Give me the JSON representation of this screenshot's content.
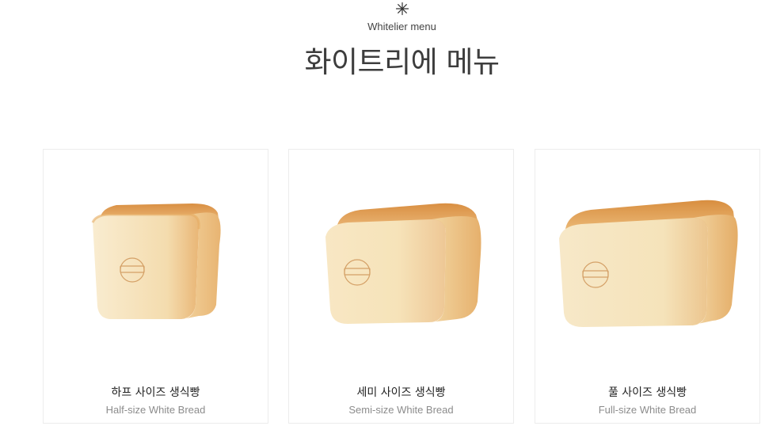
{
  "header": {
    "icon": "asterisk-icon",
    "subtitle": "Whitelier menu",
    "title": "화이트리에 메뉴"
  },
  "menu": {
    "items": [
      {
        "name": "하프 사이즈 생식빵",
        "english": "Half-size White Bread",
        "image": "half-loaf-bread-image"
      },
      {
        "name": "세미 사이즈 생식빵",
        "english": "Semi-size White Bread",
        "image": "semi-loaf-bread-image"
      },
      {
        "name": "풀 사이즈 생식빵",
        "english": "Full-size White Bread",
        "image": "full-loaf-bread-image"
      }
    ]
  },
  "colors": {
    "title": "#3d3d3d",
    "subtext": "#8c8c8c",
    "card_border": "#ececec",
    "crust": "#e3a55e",
    "crumb": "#f6e4bd"
  }
}
